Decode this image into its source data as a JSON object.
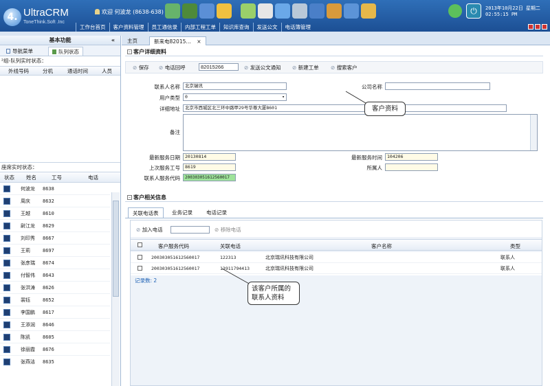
{
  "app": {
    "logo_mark": "4.",
    "title": "UltraCRM",
    "subtitle": "ToneThink.Soft .Inc",
    "welcome": "欢迎 何波龙 (8638-638)",
    "date_line1": "2013年10月22日 星期二",
    "date_line2": "02:55:15 PM"
  },
  "menu": [
    "工作台首页",
    "客户资料管理",
    "员工通信录",
    "内部工程工单",
    "知识库查询",
    "发送公文",
    "电话簿管理"
  ],
  "toolbar_icons": [
    "users-icon",
    "cash-icon",
    "monitor-icon",
    "agent-icon",
    "transfer-icon",
    "phone-icon",
    "forward-icon",
    "hangup-icon",
    "chart-icon",
    "settings-icon",
    "network-icon",
    "thumb-icon"
  ],
  "sidebar": {
    "title": "基本功能",
    "collapse": "«",
    "tabs": [
      "导航菜单",
      "队列状态"
    ],
    "queue_label": "²组-队列实时状态：",
    "queue_columns": [
      "外线号码",
      "分机",
      "通话时间",
      "人员"
    ],
    "seat_label": "座席实时状态：",
    "seat_columns": [
      "状态",
      "姓名",
      "工号",
      "电话"
    ],
    "employees": [
      {
        "name": "何波龙",
        "id": "8638"
      },
      {
        "name": "周庆",
        "id": "8632"
      },
      {
        "name": "王越",
        "id": "8610"
      },
      {
        "name": "尉江龙",
        "id": "8629"
      },
      {
        "name": "刘印秀",
        "id": "8667"
      },
      {
        "name": "王莉",
        "id": "8697"
      },
      {
        "name": "张彦瑞",
        "id": "8674"
      },
      {
        "name": "付智伟",
        "id": "8643"
      },
      {
        "name": "张洪涛",
        "id": "8626"
      },
      {
        "name": "裴钰",
        "id": "8652"
      },
      {
        "name": "李国鹏",
        "id": "8617"
      },
      {
        "name": "王添润",
        "id": "8646"
      },
      {
        "name": "陈凯",
        "id": "8605"
      },
      {
        "name": "徐丽霞",
        "id": "8676"
      },
      {
        "name": "张燕洁",
        "id": "8635"
      }
    ]
  },
  "main_tabs": [
    "主页",
    "新来电82015…"
  ],
  "customer": {
    "section_title": "客户详细资料",
    "actions": {
      "save": "保存",
      "callback": "电话回呼",
      "callback_number": "82015266",
      "notice": "发送公文通知",
      "new_order": "新建工单",
      "search": "搜索客户"
    },
    "labels": {
      "contact": "联系人名称",
      "company": "公司名称",
      "user_type": "用户类型",
      "address": "详细地址",
      "remark": "备注",
      "latest_date": "最新服务日期",
      "latest_time": "最新服务时间",
      "last_staff": "上次服务工号",
      "owner": "所属人",
      "service_code": "联系人服务代码"
    },
    "values": {
      "contact": "北京瑞讯",
      "company": "",
      "user_type": "0",
      "address": "北京市西城区北三环中路甲29号华尊大厦B601",
      "remark": "",
      "latest_date": "20130814",
      "latest_time": "104206",
      "last_staff": "8619",
      "owner": "",
      "service_code": "200303051612560017"
    },
    "callout_info": "客户资料"
  },
  "related": {
    "section_title": "客户相关信息",
    "tabs": [
      "关联电话表",
      "业务记录",
      "电话记录"
    ],
    "add_phone": "加入电话",
    "remove_phone": "移除电话",
    "columns": [
      "客户服务代码",
      "关联电话",
      "客户名称",
      "类型"
    ],
    "rows": [
      {
        "code": "200303051612560017",
        "phone": "122313",
        "name": "北京瑞讯科技有限公司",
        "type": "联系人"
      },
      {
        "code": "200303051612560017",
        "phone": "13911794413",
        "name": "北京瑞讯科技有限公司",
        "type": "联系人"
      }
    ],
    "record_count": "记录数: 2",
    "callout_contacts": "该客户所属的联系人资料"
  },
  "colors": {
    "header": "#2f6fb8",
    "accent_green": "#9ee39a",
    "readonly": "#fffbe6"
  }
}
